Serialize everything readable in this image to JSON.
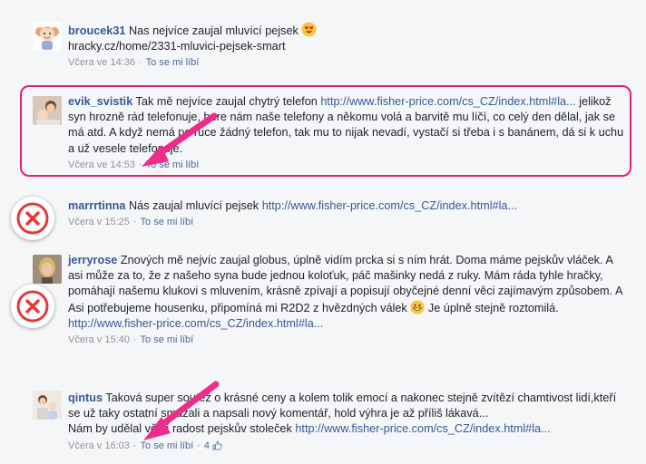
{
  "comments": [
    {
      "author": "broucek31",
      "text": "Nas nejvíce zaujal mluvící pejsek",
      "line2": "hracky.cz/home/2331-mluvici-pejsek-smart",
      "time": "Včera ve 14:36",
      "like": "To se mi líbí"
    },
    {
      "author": "evik_svistik",
      "text": "Tak mě nejvíce zaujal chytrý telefon",
      "link": "http://www.fisher-price.com/cs_CZ/index.html#la...",
      "rest": "jelikož syn hrozně rád telefonuje, bere nám naše telefony a někomu volá a barvitě mu líčí, co celý den dělal, jak se má atd. A když nemá po ruce žádný telefon, tak mu to nijak nevadí, vystačí si třeba i s banánem, dá si k uchu a už vesele telefonuje.",
      "time": "Včera ve 14:53",
      "like": "To se mi líbí"
    },
    {
      "author": "marrrtinna",
      "text": "Nás zaujal mluvící pejsek",
      "link": "http://www.fisher-price.com/cs_CZ/index.html#la...",
      "time": "Včera v 15:25",
      "like": "To se mi líbí"
    },
    {
      "author": "jerryrose",
      "text": "Znových mě nejvíc zaujal globus, úplně vidím prcka si s ním hrát. Doma máme pejskův vláček. A asi může za to, že z našeho syna bude jednou koloťuk, páč mašinky nedá z ruky. Mám ráda tyhle hračky, pomáhají našemu klukovi s mluvením, krásně zpívají a popisují obyčejné denní věci zajímavým způsobem. A Asi potřebujeme housenku, připomíná mi R2D2 z hvězdných válek",
      "after": "Je úplně stejně roztomilá.",
      "link": "http://www.fisher-price.com/cs_CZ/index.html#la...",
      "time": "Včera v 15:40",
      "like": "To se mi líbí"
    },
    {
      "author": "qintus",
      "text": "Taková super soutěž o krásné ceny a kolem tolik emocí a nakonec stejně zvítězí chamtivost lidí,kteří se už taky ostatní smazali a napsali nový komentář, hold výhra je až příliš lákavá...",
      "text2": "Nám by udělal větší radost pejskův stoleček",
      "link": "http://www.fisher-price.com/cs_CZ/index.html#la...",
      "time": "Včera v 16:03",
      "like": "To se mi líbí",
      "likes": "4"
    }
  ],
  "colors": {
    "highlight": "#e5206e",
    "arrow": "#ee2d8a",
    "reject": "#e53935",
    "link": "#365899"
  },
  "icons": [
    "heart-eyes-emoji",
    "grinning-emoji",
    "reject-x-icon",
    "thumbs-up-icon",
    "pink-arrow"
  ]
}
